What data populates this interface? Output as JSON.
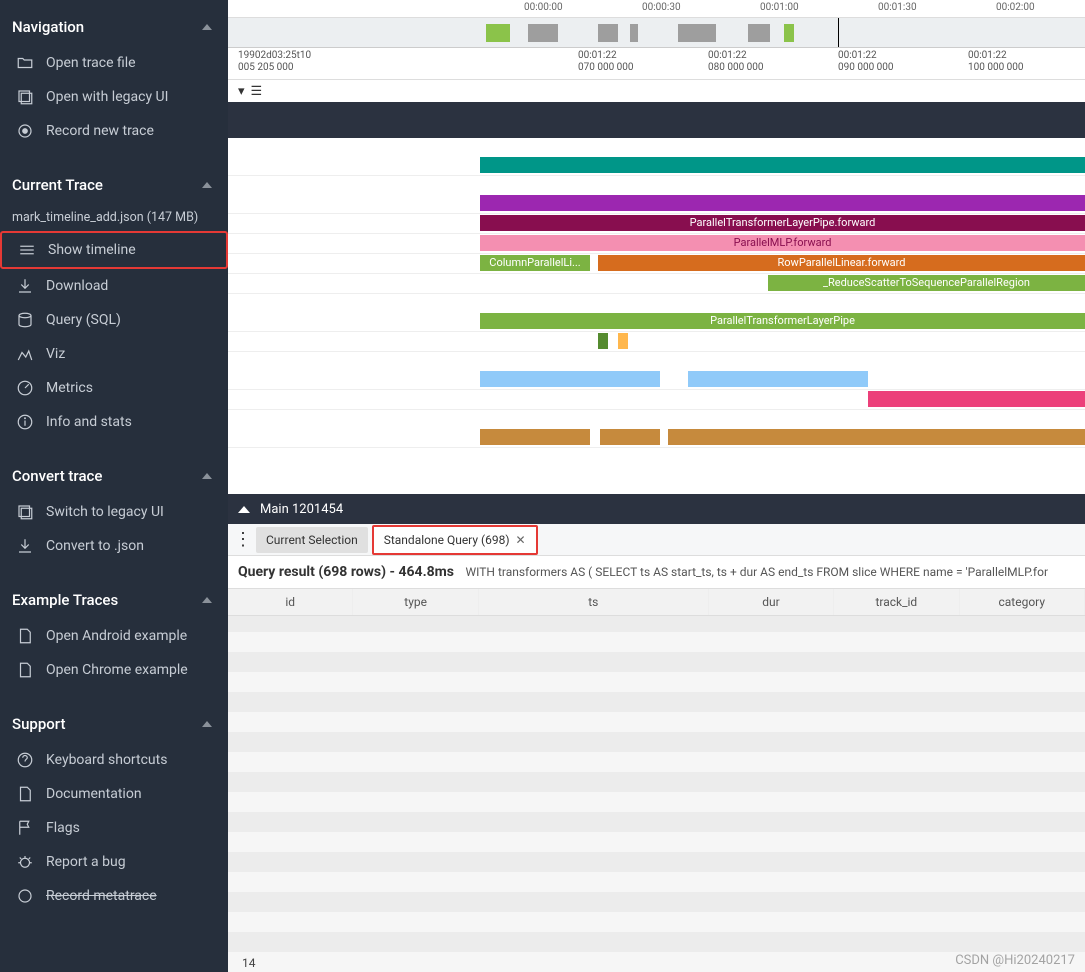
{
  "sidebar": {
    "nav_title": "Navigation",
    "nav_items": [
      "Open trace file",
      "Open with legacy UI",
      "Record new trace"
    ],
    "current_title": "Current Trace",
    "trace_file": "mark_timeline_add.json (147 MB)",
    "current_items": [
      "Show timeline",
      "Download",
      "Query (SQL)",
      "Viz",
      "Metrics",
      "Info and stats"
    ],
    "convert_title": "Convert trace",
    "convert_items": [
      "Switch to legacy UI",
      "Convert to .json"
    ],
    "example_title": "Example Traces",
    "example_items": [
      "Open Android example",
      "Open Chrome example"
    ],
    "support_title": "Support",
    "support_items": [
      "Keyboard shortcuts",
      "Documentation",
      "Flags",
      "Report a bug",
      "Record metatrace"
    ]
  },
  "ruler_ticks": [
    "00:00:00",
    "00:00:30",
    "00:01:00",
    "00:01:30",
    "00:02:00"
  ],
  "ruler2": {
    "top": "19902d03:25t10",
    "ticks": [
      {
        "t": "",
        "v": "005 205 000"
      },
      {
        "t": "00:01:22",
        "v": "070 000 000"
      },
      {
        "t": "00:01:22",
        "v": "080 000 000"
      },
      {
        "t": "00:01:22",
        "v": "090 000 000"
      },
      {
        "t": "00:01:22",
        "v": "100 000 000"
      }
    ]
  },
  "slices": {
    "ptlp_fwd": "ParallelTransformerLayerPipe.forward",
    "mlp_fwd": "ParallelMLP.forward",
    "col": "ColumnParallelLi...",
    "row": "RowParallelLinear.forward",
    "reduce": "_ReduceScatterToSequenceParallelRegion",
    "ptlp": "ParallelTransformerLayerPipe"
  },
  "details": {
    "title": "Main 1201454"
  },
  "tabs": {
    "current": "Current Selection",
    "query": "Standalone Query (698)"
  },
  "query_result": {
    "header": "Query result (698 rows) - 464.8ms",
    "sql": "WITH transformers AS ( SELECT ts AS start_ts, ts + dur AS end_ts FROM slice WHERE name = 'ParallelMLP.for",
    "columns": [
      "id",
      "type",
      "ts",
      "dur",
      "track_id",
      "category"
    ]
  },
  "watermark": "CSDN @Hi20240217",
  "cell14": "14"
}
